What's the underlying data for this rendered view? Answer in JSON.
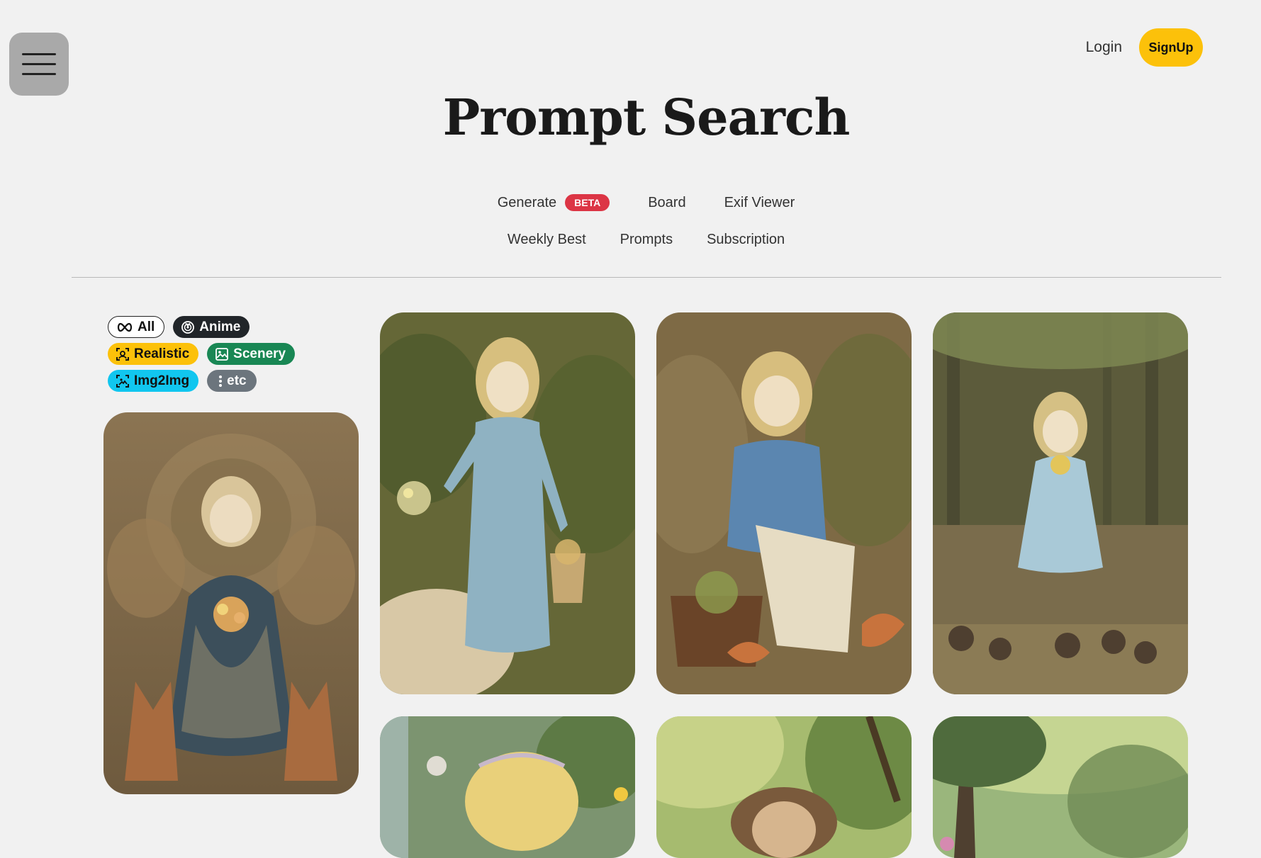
{
  "header": {
    "menu_icon": "hamburger-menu-icon",
    "login_label": "Login",
    "signup_label": "SignUp",
    "title": "Prompt Search"
  },
  "nav": {
    "row1": [
      {
        "label": "Generate",
        "badge": "BETA"
      },
      {
        "label": "Board"
      },
      {
        "label": "Exif Viewer"
      }
    ],
    "row2": [
      {
        "label": "Weekly Best"
      },
      {
        "label": "Prompts"
      },
      {
        "label": "Subscription"
      }
    ]
  },
  "filters": [
    {
      "label": "All",
      "icon": "infinity-icon",
      "color": "#ffffff"
    },
    {
      "label": "Anime",
      "icon": "anime-icon",
      "color": "#212529"
    },
    {
      "label": "Realistic",
      "icon": "realistic-icon",
      "color": "#fcc10a"
    },
    {
      "label": "Scenery",
      "icon": "scenery-icon",
      "color": "#198754"
    },
    {
      "label": "Img2Img",
      "icon": "img2img-icon",
      "color": "#11c6ef"
    },
    {
      "label": "etc",
      "icon": "more-vertical-icon",
      "color": "#6c757d"
    }
  ],
  "gallery": [
    {
      "subject": "girl in dark blue dress seated with flowers between two foxes",
      "palette": [
        "#8a7250",
        "#3d4f5a"
      ]
    },
    {
      "subject": "girl in light blue dress holding flowers and basket",
      "palette": [
        "#6d6b3e",
        "#8fb3c4"
      ]
    },
    {
      "subject": "girl in blue dress sitting with basket and foxes",
      "palette": [
        "#7e6a45",
        "#5b86b0"
      ]
    },
    {
      "subject": "girl in pale blue dress in forest with rabbits",
      "palette": [
        "#5d5c3c",
        "#a9c9d7"
      ]
    },
    {
      "subject": "blonde girl with headband among leaves",
      "palette": [
        "#7c9470",
        "#e9d07a"
      ]
    },
    {
      "subject": "girl with sun hat in park",
      "palette": [
        "#a6bb6f",
        "#7a5a3c"
      ]
    },
    {
      "subject": "green tree scenery",
      "palette": [
        "#9ab67c",
        "#4f6b3d"
      ]
    }
  ]
}
